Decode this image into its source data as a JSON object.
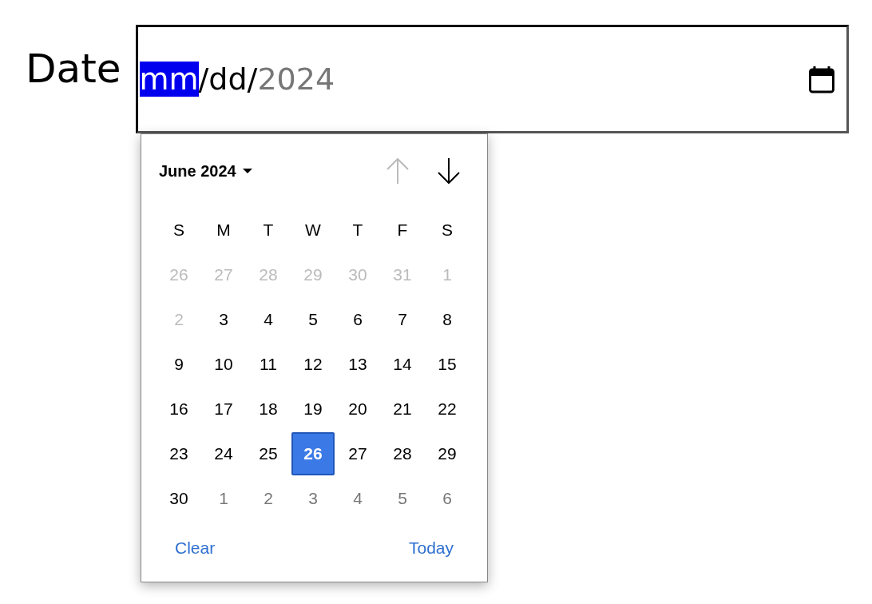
{
  "label": "Date",
  "field": {
    "segments": [
      {
        "text": "mm",
        "kind": "highlighted"
      },
      {
        "text": "/dd/",
        "kind": "text"
      },
      {
        "text": "2024",
        "kind": "dim"
      }
    ]
  },
  "calendar": {
    "month_label": "June 2024",
    "previous_disabled": true,
    "next_disabled": false,
    "weekdays": [
      "S",
      "M",
      "T",
      "W",
      "T",
      "F",
      "S"
    ],
    "weeks": [
      [
        {
          "day": "26",
          "kind": "prev",
          "selected": false
        },
        {
          "day": "27",
          "kind": "prev",
          "selected": false
        },
        {
          "day": "28",
          "kind": "prev",
          "selected": false
        },
        {
          "day": "29",
          "kind": "prev",
          "selected": false
        },
        {
          "day": "30",
          "kind": "prev",
          "selected": false
        },
        {
          "day": "31",
          "kind": "prev",
          "selected": false
        },
        {
          "day": "1",
          "kind": "prev",
          "selected": false
        }
      ],
      [
        {
          "day": "2",
          "kind": "prev",
          "selected": false
        },
        {
          "day": "3",
          "kind": "current",
          "selected": false
        },
        {
          "day": "4",
          "kind": "current",
          "selected": false
        },
        {
          "day": "5",
          "kind": "current",
          "selected": false
        },
        {
          "day": "6",
          "kind": "current",
          "selected": false
        },
        {
          "day": "7",
          "kind": "current",
          "selected": false
        },
        {
          "day": "8",
          "kind": "current",
          "selected": false
        }
      ],
      [
        {
          "day": "9",
          "kind": "current",
          "selected": false
        },
        {
          "day": "10",
          "kind": "current",
          "selected": false
        },
        {
          "day": "11",
          "kind": "current",
          "selected": false
        },
        {
          "day": "12",
          "kind": "current",
          "selected": false
        },
        {
          "day": "13",
          "kind": "current",
          "selected": false
        },
        {
          "day": "14",
          "kind": "current",
          "selected": false
        },
        {
          "day": "15",
          "kind": "current",
          "selected": false
        }
      ],
      [
        {
          "day": "16",
          "kind": "current",
          "selected": false
        },
        {
          "day": "17",
          "kind": "current",
          "selected": false
        },
        {
          "day": "18",
          "kind": "current",
          "selected": false
        },
        {
          "day": "19",
          "kind": "current",
          "selected": false
        },
        {
          "day": "20",
          "kind": "current",
          "selected": false
        },
        {
          "day": "21",
          "kind": "current",
          "selected": false
        },
        {
          "day": "22",
          "kind": "current",
          "selected": false
        }
      ],
      [
        {
          "day": "23",
          "kind": "current",
          "selected": false
        },
        {
          "day": "24",
          "kind": "current",
          "selected": false
        },
        {
          "day": "25",
          "kind": "current",
          "selected": false
        },
        {
          "day": "26",
          "kind": "current",
          "selected": true
        },
        {
          "day": "27",
          "kind": "current",
          "selected": false
        },
        {
          "day": "28",
          "kind": "current",
          "selected": false
        },
        {
          "day": "29",
          "kind": "current",
          "selected": false
        }
      ],
      [
        {
          "day": "30",
          "kind": "current",
          "selected": false
        },
        {
          "day": "1",
          "kind": "next",
          "selected": false
        },
        {
          "day": "2",
          "kind": "next",
          "selected": false
        },
        {
          "day": "3",
          "kind": "next",
          "selected": false
        },
        {
          "day": "4",
          "kind": "next",
          "selected": false
        },
        {
          "day": "5",
          "kind": "next",
          "selected": false
        },
        {
          "day": "6",
          "kind": "next",
          "selected": false
        }
      ]
    ],
    "footer": [
      "Clear",
      "Today"
    ]
  }
}
